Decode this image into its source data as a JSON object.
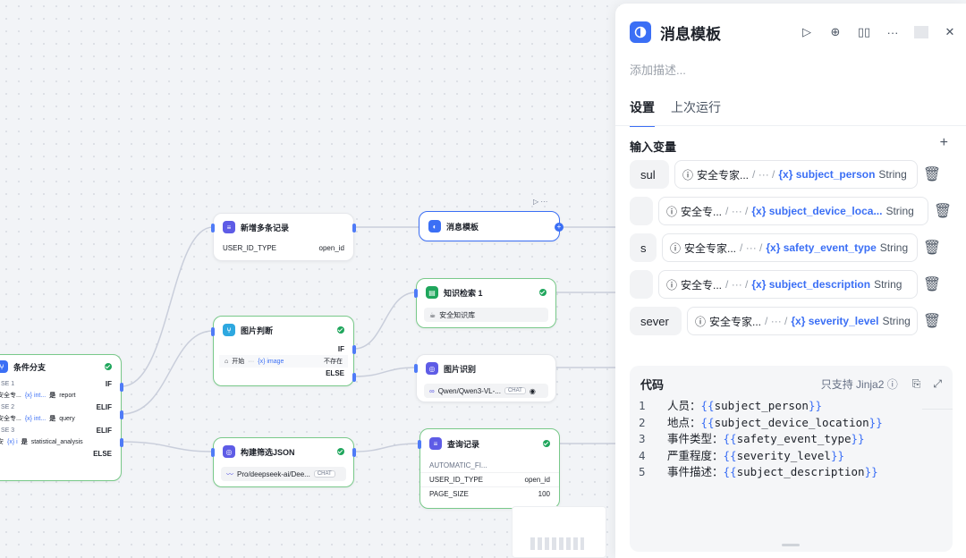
{
  "nodes": {
    "branch": {
      "title": "条件分支",
      "cases": [
        {
          "case_label": "SE 1",
          "kind": "IF",
          "src": "安全专...",
          "var": "{x} int...",
          "op": "是",
          "val": "report"
        },
        {
          "case_label": "SE 2",
          "kind": "ELIF",
          "src": "安全专...",
          "var": "{x} int...",
          "op": "是",
          "val": "query"
        },
        {
          "case_label": "SE 3",
          "kind": "ELIF",
          "src": "安",
          "var": "{x} i",
          "op": "是",
          "val": "statistical_analysis"
        }
      ],
      "else_label": "ELSE"
    },
    "add_records": {
      "title": "新增多条记录",
      "key": "USER_ID_TYPE",
      "value": "open_id"
    },
    "message_template": {
      "title": "消息模板"
    },
    "knowledge": {
      "title": "知识检索 1",
      "chip": "安全知识库"
    },
    "image_judge": {
      "title": "图片判断",
      "if_label": "IF",
      "src": "开始",
      "var": "{x} image",
      "op": "不存在",
      "else_label": "ELSE"
    },
    "image_recog": {
      "title": "图片识别",
      "model": "Qwen/Qwen3-VL-...",
      "tag": "CHAT"
    },
    "build_json": {
      "title": "构建筛选JSON",
      "model": "Pro/deepseek-ai/Dee...",
      "tag": "CHAT"
    },
    "query": {
      "title": "查询记录",
      "rows": [
        {
          "key": "AUTOMATIC_FI...",
          "value": ""
        },
        {
          "key": "USER_ID_TYPE",
          "value": "open_id"
        },
        {
          "key": "PAGE_SIZE",
          "value": "100"
        }
      ]
    }
  },
  "panel": {
    "title": "消息模板",
    "description_placeholder": "添加描述...",
    "tabs": [
      {
        "label": "设置"
      },
      {
        "label": "上次运行"
      }
    ],
    "inputs_title": "输入变量",
    "inputs": [
      {
        "name": "sul",
        "source": "安全专家...",
        "path": "/ ··· /",
        "var": "{x} subject_person",
        "type": "String"
      },
      {
        "name": "",
        "source": "安全专...",
        "path": "/ ··· /",
        "var": "{x} subject_device_loca...",
        "type": "String"
      },
      {
        "name": "s",
        "source": "安全专家...",
        "path": "/ ··· /",
        "var": "{x} safety_event_type",
        "type": "String"
      },
      {
        "name": "",
        "source": "安全专...",
        "path": "/ ··· /",
        "var": "{x} subject_description",
        "type": "String"
      },
      {
        "name": "sever",
        "source": "安全专家...",
        "path": "/ ··· /",
        "var": "{x} severity_level",
        "type": "String"
      }
    ],
    "code_title": "代码",
    "code_note": "只支持 Jinja2",
    "code_lines": [
      {
        "num": "1",
        "label": "人员：",
        "var": "subject_person"
      },
      {
        "num": "2",
        "label": "地点：",
        "var": "subject_device_location"
      },
      {
        "num": "3",
        "label": "事件类型：",
        "var": "safety_event_type"
      },
      {
        "num": "4",
        "label": "严重程度：",
        "var": "severity_level"
      },
      {
        "num": "5",
        "label": "事件描述：",
        "var": "subject_description"
      }
    ]
  },
  "colors": {
    "accent": "#3b6ff5",
    "success": "#1fa65c",
    "edge": "#c9cedb"
  }
}
